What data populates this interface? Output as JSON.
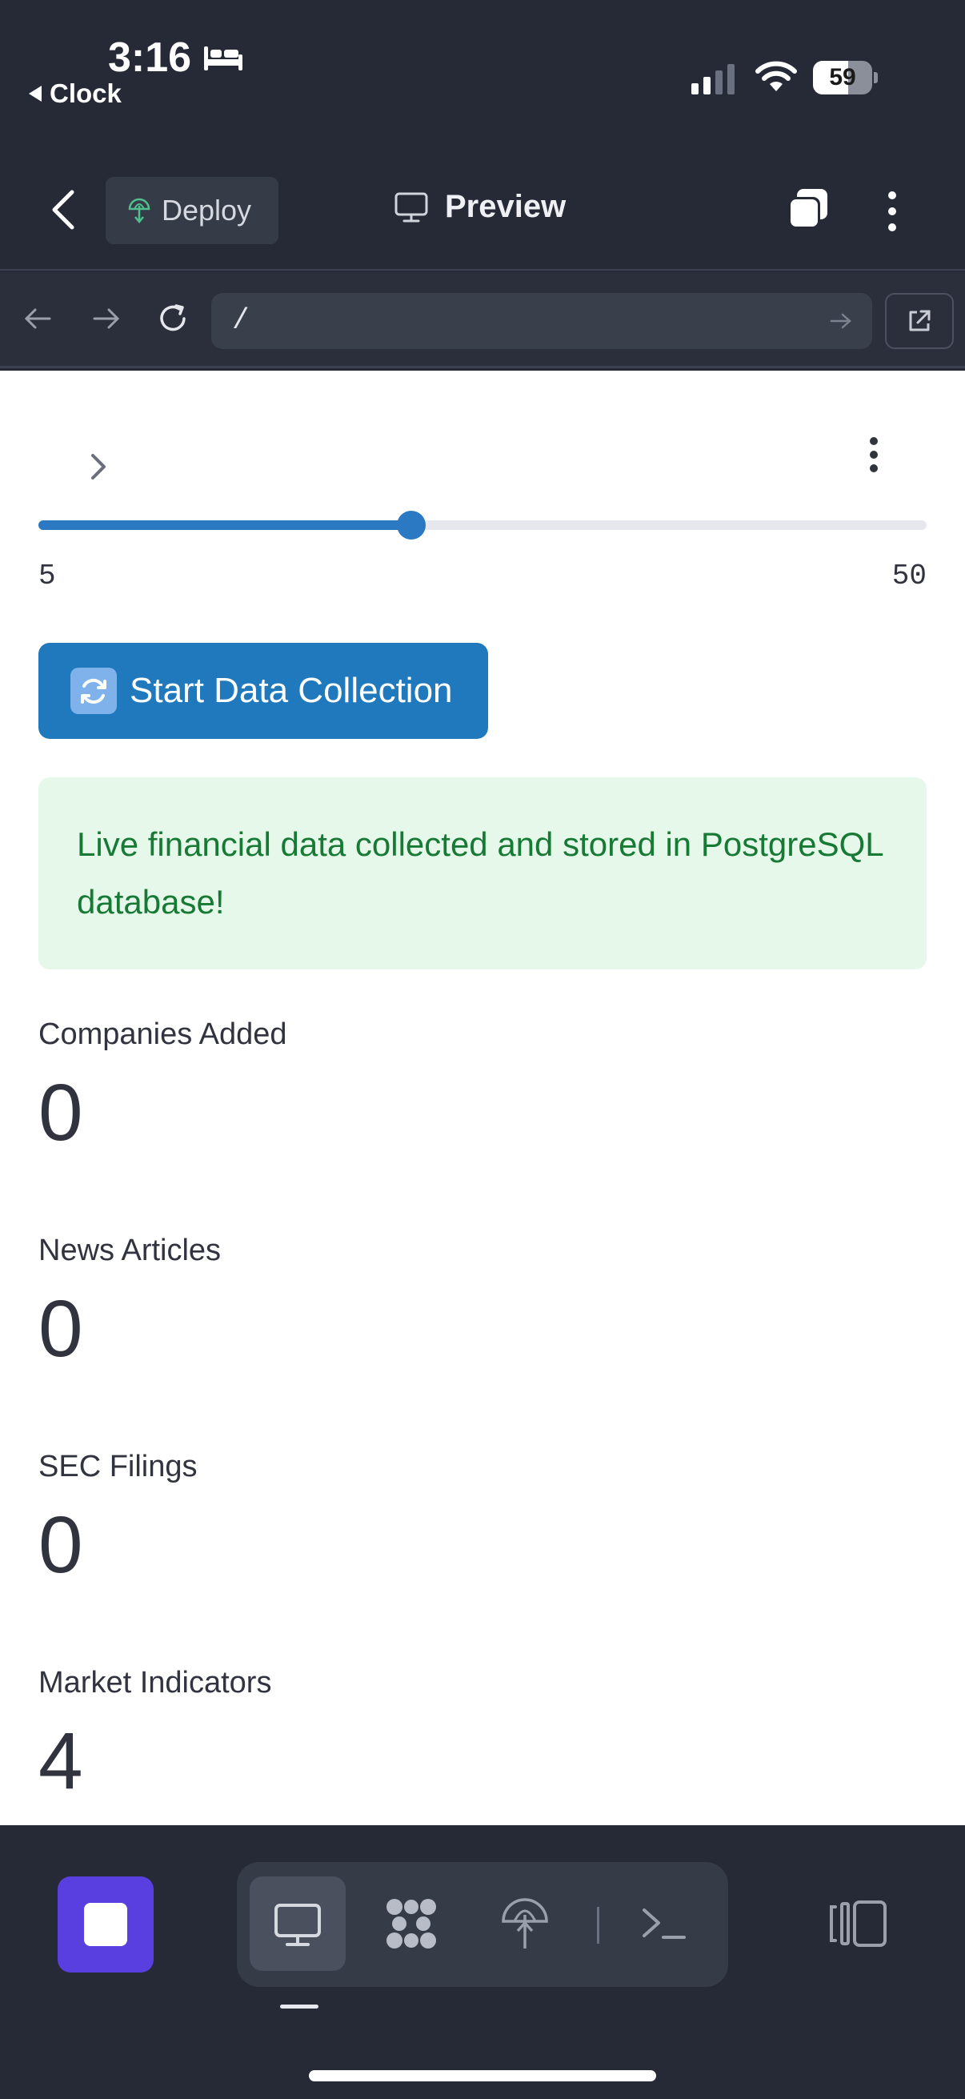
{
  "status_bar": {
    "time": "3:16",
    "back_app": "Clock",
    "battery": "59",
    "battery_level": 0.59,
    "signal_bars": 2,
    "icons": [
      "bed-icon",
      "signal-icon",
      "wifi-icon",
      "battery-icon"
    ]
  },
  "app_bar": {
    "deploy_label": "Deploy",
    "title": "Preview",
    "icons": [
      "back-chevron-icon",
      "deploy-icon",
      "monitor-icon",
      "tabs-icon",
      "more-vertical-icon"
    ]
  },
  "url_bar": {
    "url": "/",
    "icons": [
      "nav-back-icon",
      "nav-forward-icon",
      "reload-icon",
      "go-arrow-icon",
      "open-external-icon"
    ]
  },
  "content": {
    "slider": {
      "min": "5",
      "max": "50",
      "value_fraction": 0.42
    },
    "start_button_label": "Start Data Collection",
    "alert_text": "Live financial data collected and stored in PostgreSQL database!",
    "metrics": [
      {
        "label": "Companies Added",
        "value": "0"
      },
      {
        "label": "News Articles",
        "value": "0"
      },
      {
        "label": "SEC Filings",
        "value": "0"
      },
      {
        "label": "Market Indicators",
        "value": "4"
      }
    ],
    "colors": {
      "primary": "#2179bd",
      "success_bg": "#e6f8ea",
      "success_text": "#167a35"
    }
  },
  "bottom_bar": {
    "stop_color": "#5a3fe0",
    "tools": [
      "monitor-icon",
      "workspace-icon",
      "deploy-icon",
      "terminal-icon"
    ],
    "active_tool": "monitor-icon"
  }
}
